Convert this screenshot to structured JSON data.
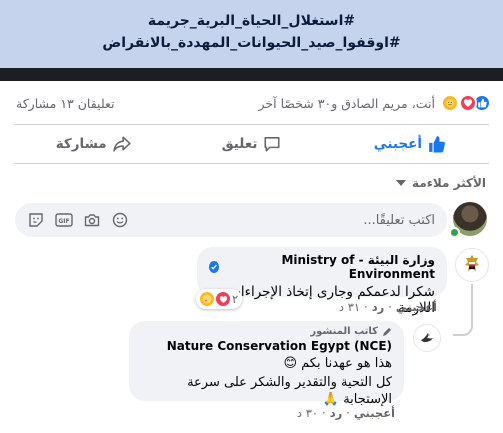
{
  "banner": {
    "line1": "#استغلال_الحياة_البرية_جريمة",
    "line2": "#اوقفوا_صيد_الحيوانات_المهددة_بالانقراض",
    "bg_color": "#c5d3ec"
  },
  "stats": {
    "reaction_names": "أنت، مريم الصادق و٣٠ شخصًا آخر",
    "comments_shares": "تعليقان ١٣ مشاركة"
  },
  "actions": {
    "like_label": "أعجبني",
    "comment_label": "تعليق",
    "share_label": "مشاركة",
    "like_color": "#1877f2"
  },
  "sort": {
    "label": "الأكثر ملاءمة"
  },
  "composer": {
    "placeholder": "اكتب تعليقًا...",
    "icons": [
      "emoji-icon",
      "camera-icon",
      "gif-icon",
      "sticker-icon"
    ]
  },
  "comments": [
    {
      "author": "وزارة البيئة - Ministry of Environment",
      "verified": true,
      "text": "شكرا لدعمكم وجارى إتخاذ الإجراءات اللازمة",
      "reaction_count": "٢",
      "like_label": "أعجبني",
      "reply_label": "رد",
      "time": "٣١ د",
      "replies": [
        {
          "badge": "كاتب المنشور",
          "author": "Nature Conservation Egypt (NCE)",
          "text_line1": "هذا هو عهدنا بكم 😊",
          "text_line2": "كل التحية والتقدير والشكر على سرعة الإستجابة 🙏",
          "like_label": "أعجبني",
          "reply_label": "رد",
          "time": "٣٠ د"
        }
      ]
    }
  ]
}
